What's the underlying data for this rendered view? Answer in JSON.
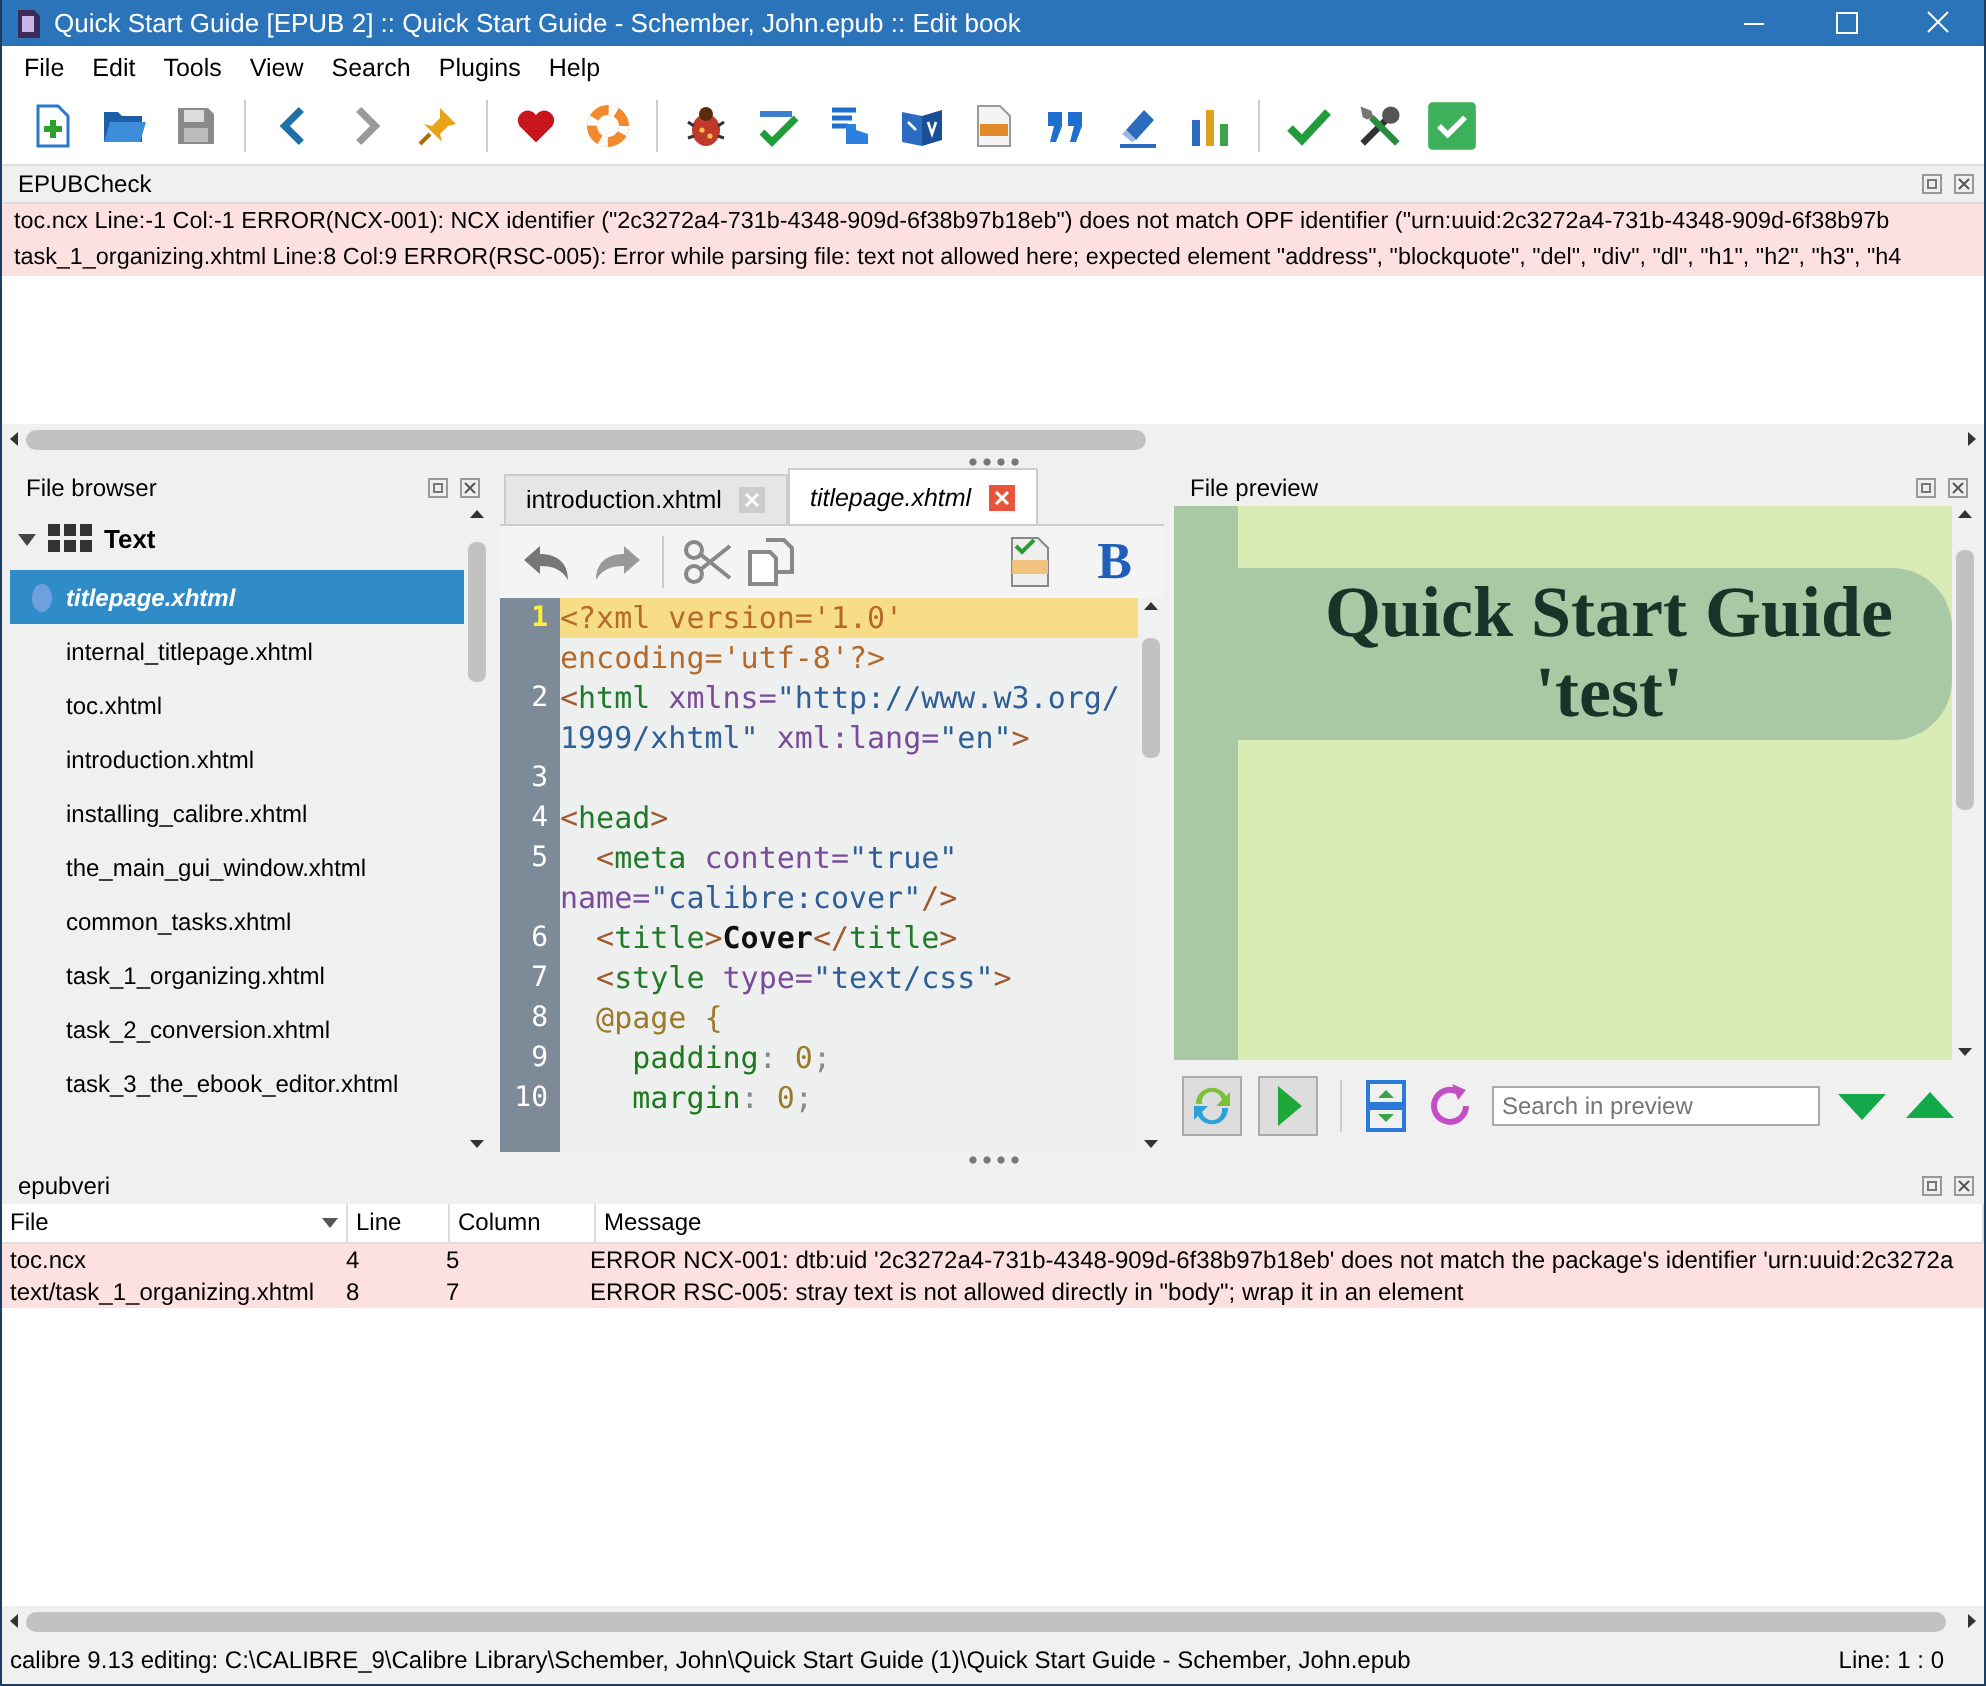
{
  "window": {
    "title": "Quick Start Guide [EPUB 2] :: Quick Start Guide - Schember, John.epub :: Edit book"
  },
  "menu": [
    "File",
    "Edit",
    "Tools",
    "View",
    "Search",
    "Plugins",
    "Help"
  ],
  "epubcheck": {
    "title": "EPUBCheck",
    "lines": [
      "toc.ncx Line:-1 Col:-1 ERROR(NCX-001): NCX identifier (\"2c3272a4-731b-4348-909d-6f38b97b18eb\") does not match OPF identifier (\"urn:uuid:2c3272a4-731b-4348-909d-6f38b97b",
      "task_1_organizing.xhtml Line:8 Col:9 ERROR(RSC-005): Error while parsing file: text not allowed here; expected element \"address\", \"blockquote\", \"del\", \"div\", \"dl\", \"h1\", \"h2\", \"h3\", \"h4"
    ]
  },
  "file_browser": {
    "title": "File browser",
    "tree": [
      {
        "label": "Text",
        "expanded": true,
        "children": [
          {
            "label": "titlepage.xhtml",
            "selected": true
          },
          {
            "label": "internal_titlepage.xhtml",
            "selected": false
          },
          {
            "label": "toc.xhtml",
            "selected": false
          },
          {
            "label": "introduction.xhtml",
            "selected": false
          },
          {
            "label": "installing_calibre.xhtml",
            "selected": false
          },
          {
            "label": "the_main_gui_window.xhtml",
            "selected": false
          },
          {
            "label": "common_tasks.xhtml",
            "selected": false
          },
          {
            "label": "task_1_organizing.xhtml",
            "selected": false
          },
          {
            "label": "task_2_conversion.xhtml",
            "selected": false
          },
          {
            "label": "task_3_the_ebook_editor.xhtml",
            "selected": false
          }
        ]
      }
    ]
  },
  "editor": {
    "tabs": [
      {
        "label": "introduction.xhtml",
        "selected": false
      },
      {
        "label": "titlepage.xhtml",
        "selected": true
      }
    ],
    "bold_button": "B",
    "lines": [
      {
        "number": "1",
        "current": true,
        "tokens": [
          {
            "text": "<?xml version='1.0'",
            "kind": "pi"
          }
        ]
      },
      {
        "current": false,
        "tokens": [
          {
            "text": "encoding='utf-8'?>",
            "kind": "pi"
          }
        ]
      },
      {
        "number": "2",
        "current": false,
        "tokens": [
          {
            "text": "<",
            "kind": "punct"
          },
          {
            "text": "html",
            "kind": "tag"
          },
          {
            "text": " xmlns=",
            "kind": "attr"
          },
          {
            "text": "\"http://www.w3.org/",
            "kind": "str"
          }
        ]
      },
      {
        "current": false,
        "tokens": [
          {
            "text": "1999/xhtml\"",
            "kind": "str"
          },
          {
            "text": " xml:lang=",
            "kind": "attr"
          },
          {
            "text": "\"en\"",
            "kind": "str"
          },
          {
            "text": ">",
            "kind": "punct"
          }
        ]
      },
      {
        "number": "3",
        "current": false
      },
      {
        "number": "4",
        "current": false,
        "tokens": [
          {
            "text": "<",
            "kind": "punct"
          },
          {
            "text": "head",
            "kind": "tag"
          },
          {
            "text": ">",
            "kind": "punct"
          }
        ]
      },
      {
        "number": "5",
        "current": false,
        "tokens": [
          {
            "text": "  <",
            "kind": "punct"
          },
          {
            "text": "meta",
            "kind": "tag"
          },
          {
            "text": " content=",
            "kind": "attr"
          },
          {
            "text": "\"true\"",
            "kind": "str"
          }
        ]
      },
      {
        "current": false,
        "tokens": [
          {
            "text": "name=",
            "kind": "attr"
          },
          {
            "text": "\"calibre:cover\"",
            "kind": "str"
          },
          {
            "text": "/>",
            "kind": "punct"
          }
        ]
      },
      {
        "number": "6",
        "current": false,
        "tokens": [
          {
            "text": "  <",
            "kind": "punct"
          },
          {
            "text": "title",
            "kind": "tag"
          },
          {
            "text": ">",
            "kind": "punct"
          },
          {
            "text": "Cover",
            "kind": "text"
          },
          {
            "text": "</",
            "kind": "punct"
          },
          {
            "text": "title",
            "kind": "tag"
          },
          {
            "text": ">",
            "kind": "punct"
          }
        ]
      },
      {
        "number": "7",
        "current": false,
        "tokens": [
          {
            "text": "  <",
            "kind": "punct"
          },
          {
            "text": "style",
            "kind": "tag"
          },
          {
            "text": " type=",
            "kind": "attr"
          },
          {
            "text": "\"text/css\"",
            "kind": "str"
          },
          {
            "text": ">",
            "kind": "punct"
          }
        ]
      },
      {
        "number": "8",
        "current": false,
        "tokens": [
          {
            "text": "  @page {",
            "kind": "at"
          }
        ]
      },
      {
        "number": "9",
        "current": false,
        "tokens": [
          {
            "text": "    padding",
            "kind": "prop"
          },
          {
            "text": ": ",
            "kind": "semi"
          },
          {
            "text": "0",
            "kind": "num"
          },
          {
            "text": ";",
            "kind": "semi"
          }
        ]
      },
      {
        "number": "10",
        "current": false,
        "tokens": [
          {
            "text": "    margin",
            "kind": "prop"
          },
          {
            "text": ": ",
            "kind": "semi"
          },
          {
            "text": "0",
            "kind": "num"
          },
          {
            "text": ";",
            "kind": "semi"
          }
        ]
      }
    ]
  },
  "preview": {
    "title": "File preview",
    "heading": "Quick Start Guide 'test'",
    "search": {
      "placeholder": "Search in preview"
    }
  },
  "epubveri": {
    "title": "epubveri",
    "columns": [
      "File",
      "Line",
      "Column",
      "Message"
    ],
    "rows": [
      [
        "toc.ncx",
        "4",
        "5",
        "ERROR NCX-001: dtb:uid '2c3272a4-731b-4348-909d-6f38b97b18eb' does not match the package's identifier 'urn:uuid:2c3272a"
      ],
      [
        "text/task_1_organizing.xhtml",
        "8",
        "7",
        "ERROR RSC-005: stray text is not allowed directly in \"body\"; wrap it in an element"
      ]
    ]
  },
  "status_bar": {
    "left": "calibre 9.13 editing: C:\\CALIBRE_9\\Calibre Library\\Schember, John\\Quick Start Guide (1)\\Quick Start Guide - Schember, John.epub",
    "right": "Line: 1 : 0"
  }
}
